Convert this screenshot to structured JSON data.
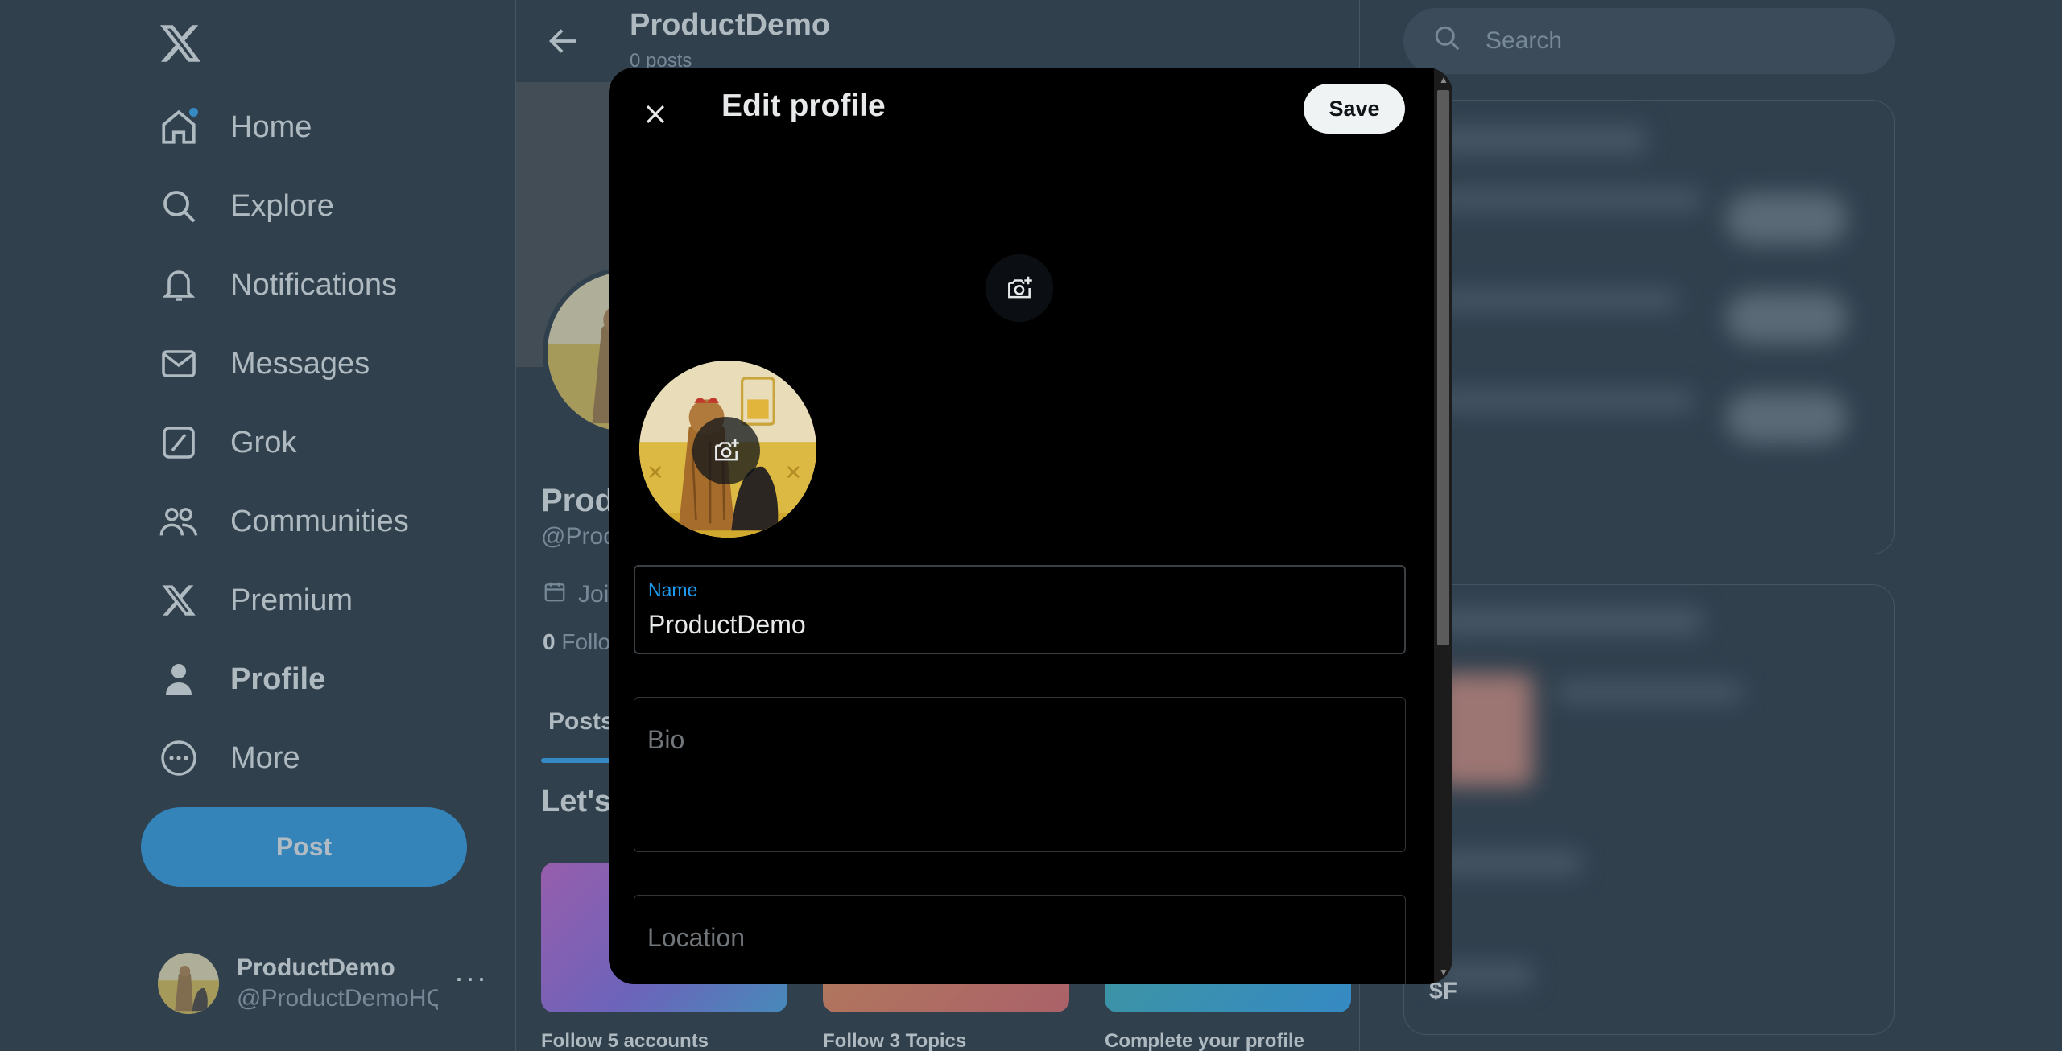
{
  "nav": {
    "items": [
      {
        "label": "Home",
        "icon": "home-icon"
      },
      {
        "label": "Explore",
        "icon": "search-icon"
      },
      {
        "label": "Notifications",
        "icon": "bell-icon"
      },
      {
        "label": "Messages",
        "icon": "envelope-icon"
      },
      {
        "label": "Grok",
        "icon": "grok-icon"
      },
      {
        "label": "Communities",
        "icon": "people-icon"
      },
      {
        "label": "Premium",
        "icon": "x-logo-icon"
      },
      {
        "label": "Profile",
        "icon": "person-icon"
      },
      {
        "label": "More",
        "icon": "more-circle-icon"
      }
    ],
    "post_label": "Post",
    "account": {
      "name": "ProductDemo",
      "handle": "@ProductDemoHQ",
      "more": "···"
    }
  },
  "profile": {
    "header_title": "ProductDemo",
    "post_count": "0 posts",
    "name": "Prod",
    "handle": "@Proc",
    "joined": "Joi",
    "following_count": "0",
    "following_label": "Follo",
    "tab": "Posts",
    "lets_heading": "Let's",
    "cards": [
      {
        "label": "Follow 5 accounts"
      },
      {
        "label": "Follow 3 Topics"
      },
      {
        "label": "Complete your profile"
      }
    ]
  },
  "right": {
    "search_placeholder": "Search",
    "price_text": "$F"
  },
  "modal": {
    "title": "Edit profile",
    "save_label": "Save",
    "fields": {
      "name_label": "Name",
      "name_value": "ProductDemo",
      "bio_placeholder": "Bio",
      "location_placeholder": "Location"
    }
  },
  "colors": {
    "accent": "#1d9bf0",
    "background": "#15202b",
    "modal_bg": "#000000"
  }
}
